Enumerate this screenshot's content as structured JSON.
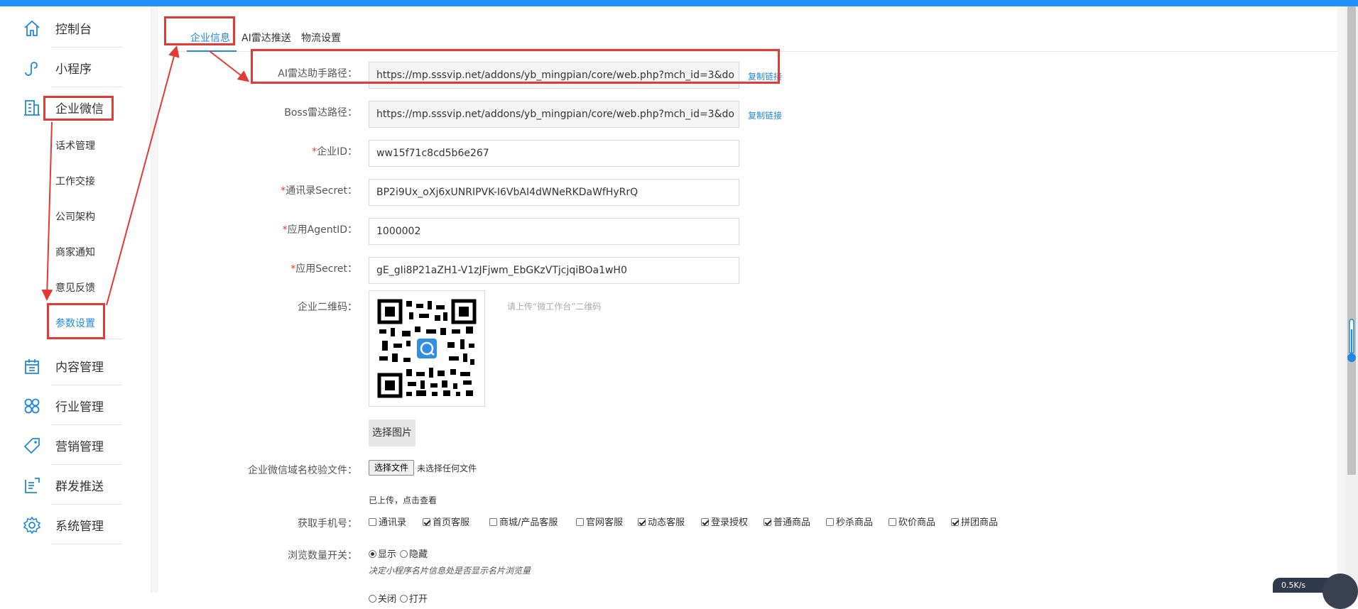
{
  "sidebar": {
    "items": [
      {
        "label": "控制台",
        "icon": "home-icon"
      },
      {
        "label": "小程序",
        "icon": "mini-program-icon"
      },
      {
        "label": "企业微信",
        "icon": "building-icon"
      },
      {
        "label": "内容管理",
        "icon": "calendar-icon"
      },
      {
        "label": "行业管理",
        "icon": "grid-icon"
      },
      {
        "label": "营销管理",
        "icon": "tag-icon"
      },
      {
        "label": "群发推送",
        "icon": "send-icon"
      },
      {
        "label": "系统管理",
        "icon": "gear-icon"
      }
    ],
    "sub_items": [
      {
        "label": "话术管理"
      },
      {
        "label": "工作交接"
      },
      {
        "label": "公司架构"
      },
      {
        "label": "商家通知"
      },
      {
        "label": "意见反馈"
      },
      {
        "label": "参数设置",
        "active": true
      }
    ]
  },
  "tabs": [
    {
      "label": "企业信息",
      "active": true
    },
    {
      "label": "AI雷达推送"
    },
    {
      "label": "物流设置"
    }
  ],
  "form": {
    "ai_radar_path": {
      "label": "AI雷达助手路径：",
      "value": "https://mp.sssvip.net/addons/yb_mingpian/core/web.php?mch_id=3&do",
      "copy": "复制链接"
    },
    "boss_radar_path": {
      "label": "Boss雷达路径：",
      "value": "https://mp.sssvip.net/addons/yb_mingpian/core/web.php?mch_id=3&do",
      "copy": "复制链接"
    },
    "corp_id": {
      "label": "企业ID：",
      "value": "ww15f71c8cd5b6e267"
    },
    "contacts_secret": {
      "label": "通讯录Secret：",
      "value": "BP2i9Ux_oXj6xUNRIPVK-I6VbAI4dWNeRKDaWfHyRrQ"
    },
    "agent_id": {
      "label": "应用AgentID：",
      "value": "1000002"
    },
    "app_secret": {
      "label": "应用Secret：",
      "value": "gE_gIi8P21aZH1-V1zJFjwm_EbGKzVTjcjqiBOa1wH0"
    },
    "qr_code": {
      "label": "企业二维码：",
      "hint": "请上传“微工作台”二维码",
      "select_button": "选择图片"
    },
    "domain_file": {
      "label": "企业微信域名校验文件：",
      "file_button": "选择文件",
      "file_status": "未选择任何文件",
      "uploaded_text": "已上传，点击查看"
    },
    "phone": {
      "label": "获取手机号：",
      "options": [
        {
          "label": "通讯录",
          "checked": false
        },
        {
          "label": "首页客服",
          "checked": true
        },
        {
          "label": "商城/产品客服",
          "checked": false
        },
        {
          "label": "官网客服",
          "checked": false
        },
        {
          "label": "动态客服",
          "checked": true
        },
        {
          "label": "登录授权",
          "checked": true
        },
        {
          "label": "普通商品",
          "checked": true
        },
        {
          "label": "秒杀商品",
          "checked": false
        },
        {
          "label": "砍价商品",
          "checked": false
        },
        {
          "label": "拼团商品",
          "checked": true
        }
      ]
    },
    "view_count": {
      "label": "浏览数量开关：",
      "options": [
        {
          "label": "显示",
          "checked": true
        },
        {
          "label": "隐藏",
          "checked": false
        }
      ],
      "hint": "决定小程序名片信息处是否显示名片浏览量"
    },
    "next_row": {
      "options": [
        {
          "label": "关闭",
          "checked": false
        },
        {
          "label": "打开",
          "checked": false
        }
      ]
    }
  },
  "widget": {
    "speed": "0.5K/s"
  },
  "colors": {
    "accent": "#1e88e5",
    "topbar": "#1e90ff",
    "annotation": "#e53935"
  }
}
